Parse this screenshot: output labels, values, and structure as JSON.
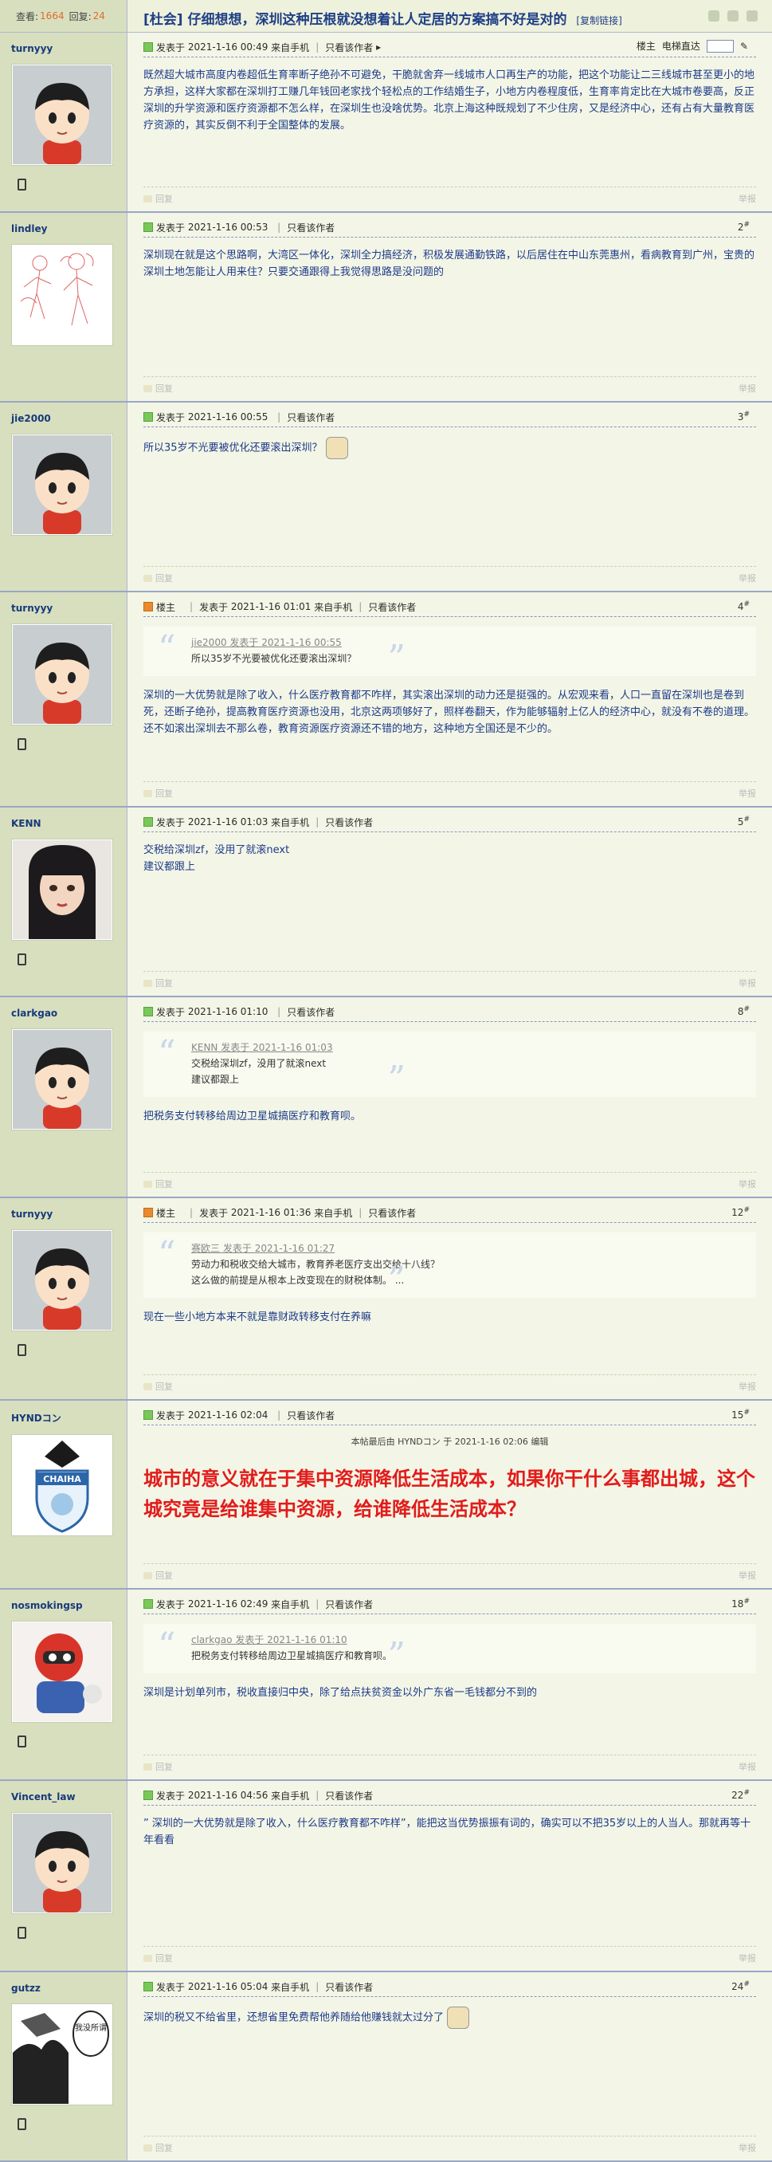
{
  "header": {
    "views_label": "查看:",
    "views": "1664",
    "replies_label": "回复:",
    "replies": "24",
    "title": "[杜会] 仔细想想，深圳这种压根就没想着让人定居的方案搞不好是对的",
    "copy_link": "[复制链接]"
  },
  "common": {
    "posted_prefix": "发表于",
    "only_author": "只看该作者",
    "reply": "回复",
    "report": "举报",
    "op_badge": "楼主",
    "quote_posted": "发表于"
  },
  "posts": [
    {
      "user": "turnyyy",
      "avatar": "boy",
      "op": false,
      "time": "2021-1-16 00:49",
      "source": "来自手机",
      "first_floor": true,
      "floor_label": "楼主",
      "tool_label": "电梯直达",
      "content": "既然超大城市高度内卷超低生育率断子绝孙不可避免，干脆就舍弃一线城市人口再生产的功能，把这个功能让二三线城市甚至更小的地方承担，这样大家都在深圳打工赚几年钱回老家找个轻松点的工作结婚生子，小地方内卷程度低，生育率肯定比在大城市卷要高，反正深圳的升学资源和医疗资源都不怎么样，在深圳生也没啥优势。北京上海这种既规划了不少住房，又是经济中心，还有占有大量教育医疗资源的，其实反倒不利于全国整体的发展。"
    },
    {
      "user": "lindley",
      "avatar": "sketch",
      "op": false,
      "time": "2021-1-16 00:53",
      "source": "",
      "floor": "2",
      "content": "深圳现在就是这个思路啊，大湾区一体化，深圳全力搞经济，积极发展通勤铁路，以后居住在中山东莞惠州，看病教育到广州，宝贵的深圳土地怎能让人用来住？只要交通跟得上我觉得思路是没问题的"
    },
    {
      "user": "jie2000",
      "avatar": "boy",
      "op": false,
      "time": "2021-1-16 00:55",
      "source": "",
      "floor": "3",
      "content": "所以35岁不光要被优化还要滚出深圳？"
    },
    {
      "user": "turnyyy",
      "avatar": "boy",
      "op": true,
      "time": "2021-1-16 01:01",
      "source": "来自手机",
      "floor": "4",
      "quote_user": "jie2000",
      "quote_time": "2021-1-16 00:55",
      "quote_text": "所以35岁不光要被优化还要滚出深圳？",
      "content": "深圳的一大优势就是除了收入，什么医疗教育都不咋样，其实滚出深圳的动力还是挺强的。从宏观来看，人口一直留在深圳也是卷到死，还断子绝孙，提高教育医疗资源也没用，北京这两项够好了，照样卷翻天，作为能够辐射上亿人的经济中心，就没有不卷的道理。还不如滚出深圳去不那么卷，教育资源医疗资源还不错的地方，这种地方全国还是不少的。"
    },
    {
      "user": "KENN",
      "avatar": "girl",
      "op": false,
      "time": "2021-1-16 01:03",
      "source": "来自手机",
      "floor": "5",
      "content_lines": [
        "交税给深圳zf，没用了就滚next",
        "建议都跟上"
      ]
    },
    {
      "user": "clarkgao",
      "avatar": "boy",
      "op": false,
      "time": "2021-1-16 01:10",
      "source": "",
      "floor": "8",
      "quote_user": "KENN",
      "quote_time": "2021-1-16 01:03",
      "quote_lines": [
        "交税给深圳zf，没用了就滚next",
        "建议都跟上"
      ],
      "content": "把税务支付转移给周边卫星城搞医疗和教育呗。"
    },
    {
      "user": "turnyyy",
      "avatar": "boy",
      "op": true,
      "time": "2021-1-16 01:36",
      "source": "来自手机",
      "floor": "12",
      "quote_user": "赛欧三",
      "quote_time": "2021-1-16 01:27",
      "quote_lines": [
        "劳动力和税收交给大城市，教育养老医疗支出交给十八线？",
        "这么做的前提是从根本上改变现在的财税体制。 ..."
      ],
      "content": "现在一些小地方本来不就是靠财政转移支付在养嘛"
    },
    {
      "user": "HYNDコン",
      "avatar": "badge",
      "op": false,
      "time": "2021-1-16 02:04",
      "source": "",
      "floor": "15",
      "edited": "本帖最后由 HYNDコン 于 2021-1-16 02:06 编辑",
      "badge_text": "CHAIHA",
      "content_big": "城市的意义就在于集中资源降低生活成本，如果你干什么事都出城，这个城究竟是给谁集中资源，给谁降低生活成本？"
    },
    {
      "user": "nosmokingsp",
      "avatar": "robot",
      "op": false,
      "time": "2021-1-16 02:49",
      "source": "来自手机",
      "floor": "18",
      "quote_user": "clarkgao",
      "quote_time": "2021-1-16 01:10",
      "quote_text": "把税务支付转移给周边卫星城搞医疗和教育呗。",
      "content": "深圳是计划单列市，税收直接归中央，除了给点扶贫资金以外广东省一毛钱都分不到的"
    },
    {
      "user": "Vincent_law",
      "avatar": "boy",
      "op": false,
      "time": "2021-1-16 04:56",
      "source": "来自手机",
      "floor": "22",
      "content": "” 深圳的一大优势就是除了收入，什么医疗教育都不咋样”，能把这当优势振振有词的，确实可以不把35岁以上的人当人。那就再等十年看看"
    },
    {
      "user": "gutzz",
      "avatar": "manga",
      "op": false,
      "time": "2021-1-16 05:04",
      "source": "来自手机",
      "floor": "24",
      "manga_text": "我没所谓",
      "content": "深圳的税又不给省里，还想省里免费帮他养随给他赚钱就太过分了"
    }
  ]
}
